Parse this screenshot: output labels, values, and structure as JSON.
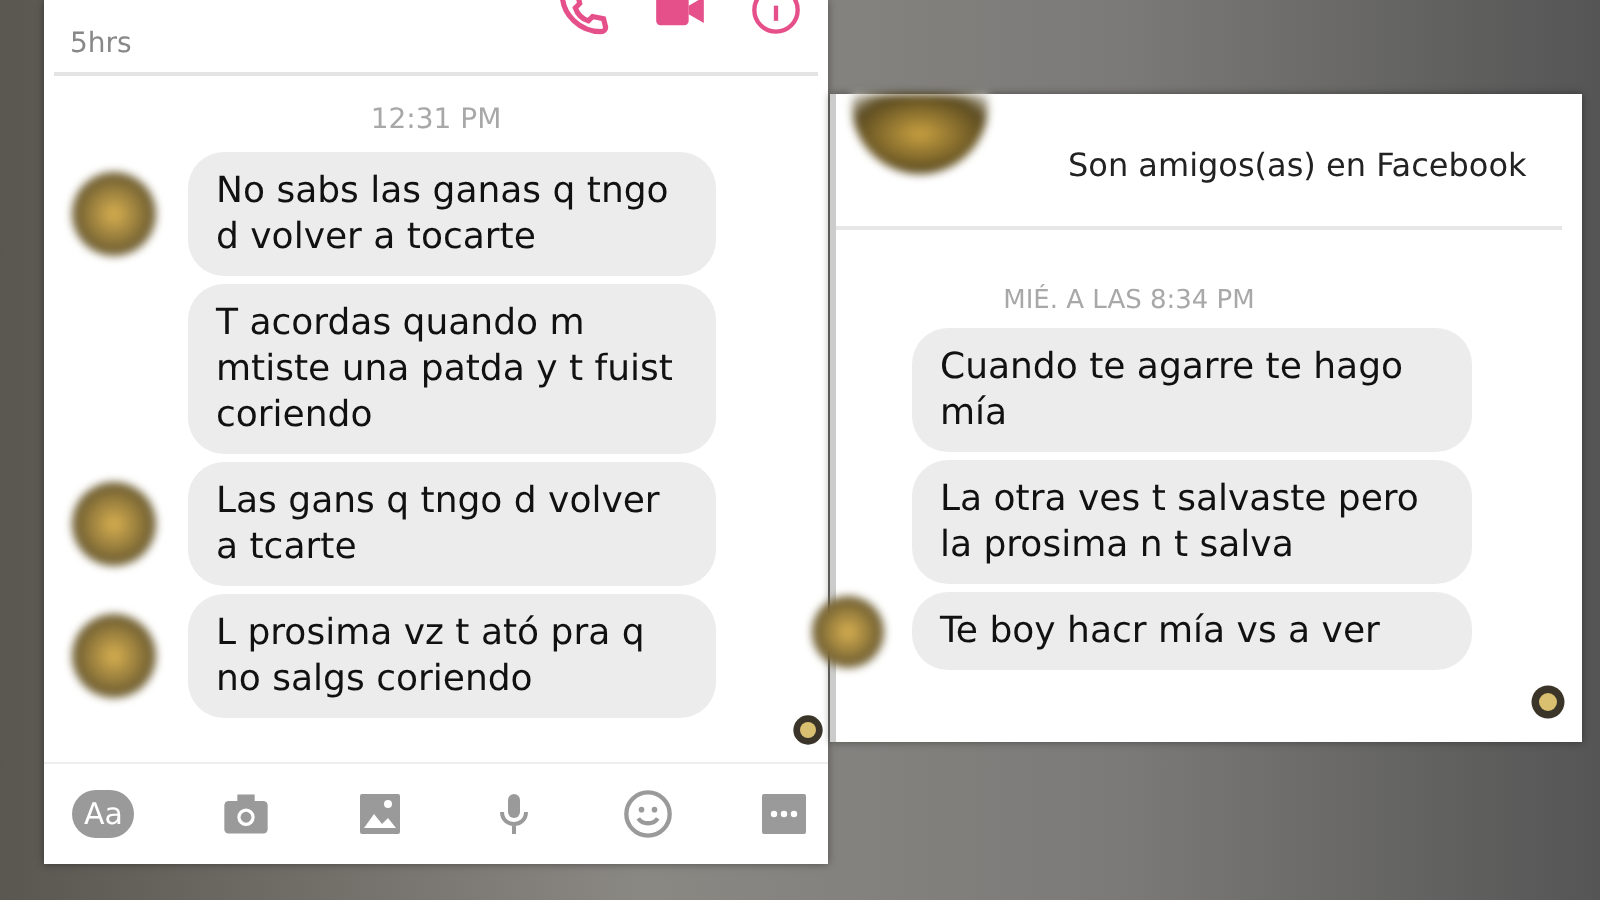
{
  "left_chat": {
    "last_active": "5hrs",
    "timestamp": "12:31 PM",
    "messages": [
      {
        "text": "No sabs las ganas q tngo d volver a tocarte",
        "avatar": true
      },
      {
        "text": "T acordas quando m mtiste una patda y t fuist coriendo",
        "avatar": false
      },
      {
        "text": "Las gans q tngo d volver a tcarte",
        "avatar": true
      },
      {
        "text": "L prosima vz t ató pra q no salgs coriendo",
        "avatar": true
      }
    ],
    "composer": {
      "text_button": "Aa"
    }
  },
  "right_chat": {
    "friend_notice": "Son amigos(as) en Facebook",
    "timestamp": "MIÉ. A LAS 8:34 PM",
    "messages": [
      {
        "text": "Cuando te agarre te hago mía",
        "avatar": false
      },
      {
        "text": "La otra ves t salvaste pero la prosima n t salva",
        "avatar": false
      },
      {
        "text": "Te boy hacr mía vs a ver",
        "avatar": true
      }
    ]
  }
}
